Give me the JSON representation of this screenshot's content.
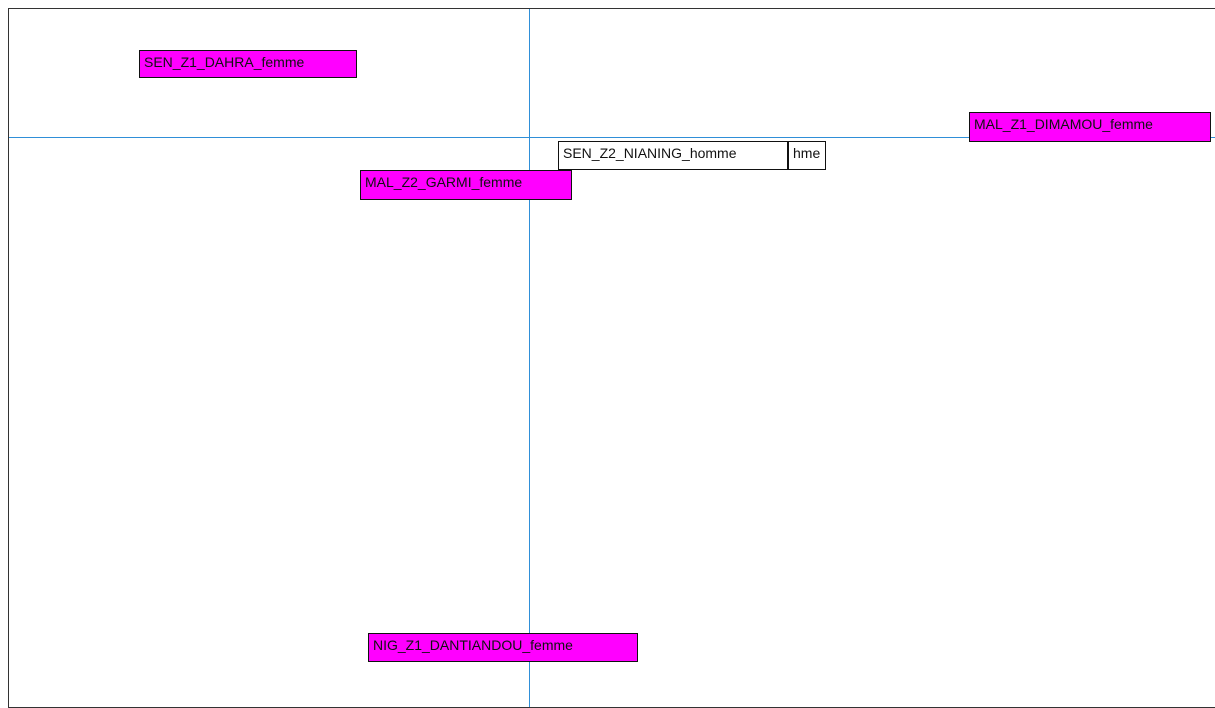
{
  "chart_data": {
    "type": "scatter",
    "title": "",
    "xlabel": "",
    "ylabel": "",
    "points": [
      {
        "label": "SEN_Z1_DAHRA_femme",
        "color": "#ff00ff"
      },
      {
        "label": "MAL_Z1_DIMAMOU_femme",
        "color": "#ff00ff"
      },
      {
        "label": "SEN_Z2_NIANING_homme",
        "color": "#ffffff"
      },
      {
        "label": "hme",
        "color": "#ffffff"
      },
      {
        "label": "MAL_Z2_GARMI_femme",
        "color": "#ff00ff"
      },
      {
        "label": "NIG_Z1_DANTIANDOU_femme",
        "color": "#ff00ff"
      }
    ]
  },
  "colors": {
    "axis_line": "#2f8fd8",
    "label_border": "#111111"
  }
}
